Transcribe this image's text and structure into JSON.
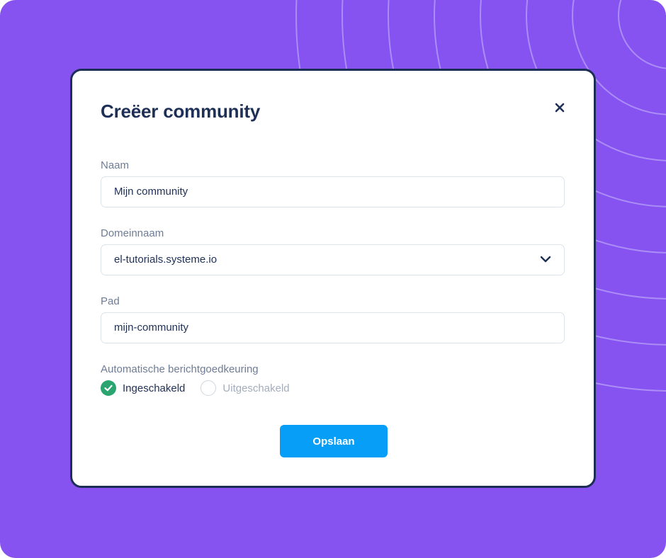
{
  "dialog": {
    "title": "Creëer community",
    "close_icon": "close-icon"
  },
  "form": {
    "name": {
      "label": "Naam",
      "value": "Mijn community"
    },
    "domain": {
      "label": "Domeinnaam",
      "value": "el-tutorials.systeme.io",
      "icon": "chevron-down-icon"
    },
    "path": {
      "label": "Pad",
      "value": "mijn-community"
    },
    "auto_approval": {
      "label": "Automatische berichtgoedkeuring",
      "options": [
        {
          "label": "Ingeschakeld",
          "selected": true
        },
        {
          "label": "Uitgeschakeld",
          "selected": false
        }
      ]
    },
    "save_label": "Opslaan"
  },
  "colors": {
    "background": "#8653f0",
    "title": "#1f3056",
    "modal_border": "#1c2e55",
    "primary_button": "#069ef7",
    "radio_checked": "#2aa56f"
  }
}
